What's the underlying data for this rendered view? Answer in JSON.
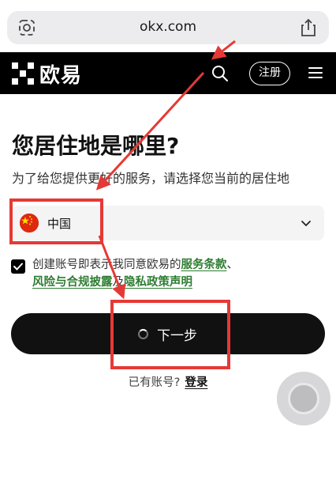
{
  "browser": {
    "url": "okx.com"
  },
  "header": {
    "logo_text": "欧易",
    "register_label": "注册"
  },
  "main": {
    "title": "您居住地是哪里?",
    "subtitle": "为了给您提供更好的服务，请选择您当前的居住地",
    "region": {
      "selected": "中国"
    },
    "agreement": {
      "checked": true,
      "text_before": "创建账号即表示我同意欧易的",
      "terms_link": "服务条款",
      "separator": "、",
      "risk_link": "风险与合规披露",
      "and_text": "及",
      "privacy_link": "隐私政策声明"
    },
    "next_button_label": "下一步",
    "login_prompt": "已有账号?",
    "login_link": "登录"
  },
  "colors": {
    "header_bg": "#000000",
    "link_green": "#2e7d32",
    "annotation_red": "#e53935",
    "flag_red": "#de2910"
  },
  "icons": [
    "search-icon",
    "share-icon",
    "page-settings-icon",
    "menu-icon",
    "chevron-down-icon",
    "china-flag-icon",
    "okx-logo-icon",
    "loading-spinner-icon"
  ]
}
